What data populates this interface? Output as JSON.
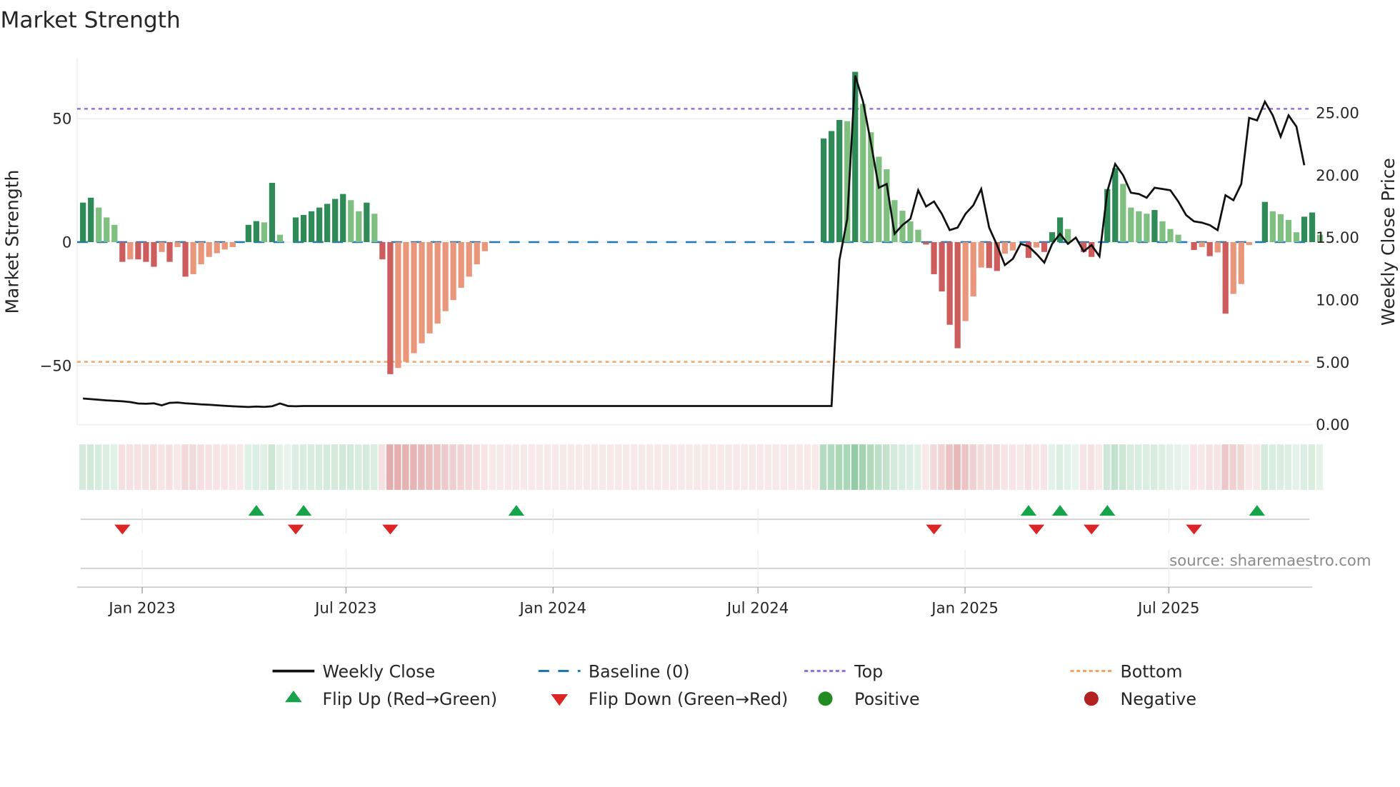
{
  "chart_data": {
    "type": "bar",
    "title": "Market Strength",
    "ylabel": "Market Strength",
    "y2label": "Weekly Close Price",
    "ylim": [
      -74,
      74.6
    ],
    "y2lim": [
      0,
      29.4
    ],
    "yticks": [
      {
        "v": 50,
        "label": "50"
      },
      {
        "v": 0,
        "label": "0"
      },
      {
        "v": -50,
        "label": "−50"
      }
    ],
    "y2ticks": [
      {
        "v": 0,
        "label": "0.00"
      },
      {
        "v": 5,
        "label": "5.00"
      },
      {
        "v": 10,
        "label": "10.00"
      },
      {
        "v": 15,
        "label": "15.00"
      },
      {
        "v": 20,
        "label": "20.00"
      },
      {
        "v": 25,
        "label": "25.00"
      }
    ],
    "xticks": [
      {
        "date": "2023-01-01",
        "label": "Jan 2023"
      },
      {
        "date": "2023-07-01",
        "label": "Jul 2023"
      },
      {
        "date": "2024-01-01",
        "label": "Jan 2024"
      },
      {
        "date": "2024-07-01",
        "label": "Jul 2024"
      },
      {
        "date": "2025-01-01",
        "label": "Jan 2025"
      },
      {
        "date": "2025-07-01",
        "label": "Jul 2025"
      }
    ],
    "start_date": "2022-11-07",
    "interval_days": 7,
    "top_level": 54,
    "bottom_level": -48.5,
    "baseline": 0,
    "strength": [
      16,
      18,
      14,
      10,
      7,
      -8,
      -7,
      -7,
      -8,
      -10,
      -4,
      -8,
      -2,
      -14,
      -13,
      -9,
      -6,
      -4.5,
      -3,
      -2,
      0,
      7,
      8.5,
      8,
      24,
      3,
      0,
      10,
      11,
      12.5,
      14,
      15.5,
      17.5,
      19.5,
      17,
      12.5,
      16,
      11.5,
      -7,
      -53.5,
      -51,
      -48.5,
      -45,
      -41,
      -37,
      -33,
      -28,
      -23.5,
      -18.5,
      -14,
      -9,
      -3.7,
      0,
      0,
      0,
      0,
      0,
      0,
      0,
      0,
      0,
      0,
      0,
      0,
      0,
      0,
      0,
      0,
      0,
      0,
      0,
      0,
      0,
      0,
      0,
      0,
      0,
      0,
      0,
      0,
      0,
      0,
      0,
      0,
      0,
      0,
      0,
      0,
      0,
      0,
      0,
      0,
      0,
      0,
      42,
      45,
      49.5,
      49,
      69,
      56,
      44.5,
      34.6,
      29.5,
      17,
      12.7,
      8.4,
      5,
      -1,
      -13,
      -20,
      -33.5,
      -43,
      -32,
      -22,
      -10.3,
      -10.5,
      -11.7,
      -4.7,
      -3.4,
      0,
      -6.4,
      -2.2,
      -4,
      4,
      10,
      5.3,
      0,
      -4,
      -6,
      0,
      21.5,
      30,
      23.6,
      14,
      12.5,
      11.5,
      13,
      8.4,
      5.3,
      3,
      0,
      -3.2,
      -2,
      -5.7,
      -4.2,
      -29,
      -21,
      -17,
      -1.2,
      0,
      16.3,
      12.5,
      11.3,
      9,
      4,
      10.3,
      12,
      3
    ],
    "weekly_close": [
      2.1,
      2.05,
      2.0,
      1.95,
      1.92,
      1.88,
      1.82,
      1.7,
      1.68,
      1.72,
      1.55,
      1.75,
      1.78,
      1.72,
      1.68,
      1.63,
      1.6,
      1.56,
      1.52,
      1.48,
      1.45,
      1.42,
      1.46,
      1.43,
      1.48,
      1.7,
      1.5,
      1.48,
      1.5,
      1.5,
      1.5,
      1.5,
      1.5,
      1.5,
      1.5,
      1.5,
      1.5,
      1.5,
      1.5,
      1.5,
      1.5,
      1.5,
      1.5,
      1.5,
      1.5,
      1.5,
      1.5,
      1.5,
      1.5,
      1.5,
      1.5,
      1.5,
      1.5,
      1.5,
      1.5,
      1.5,
      1.5,
      1.5,
      1.5,
      1.5,
      1.5,
      1.5,
      1.5,
      1.5,
      1.5,
      1.5,
      1.5,
      1.5,
      1.5,
      1.5,
      1.5,
      1.5,
      1.5,
      1.5,
      1.5,
      1.5,
      1.5,
      1.5,
      1.5,
      1.5,
      1.5,
      1.5,
      1.5,
      1.5,
      1.5,
      1.5,
      1.5,
      1.5,
      1.5,
      1.5,
      1.5,
      1.5,
      1.5,
      1.5,
      1.5,
      1.5,
      13.2,
      16.5,
      28,
      25.9,
      22.6,
      19,
      19.3,
      15.3,
      16,
      16.5,
      18.8,
      17.5,
      17.9,
      16.9,
      15.6,
      15.8,
      16.9,
      17.6,
      18.9,
      15.8,
      14.4,
      12.8,
      13.3,
      14.5,
      14.3,
      13.7,
      13,
      14.5,
      15.3,
      14.5,
      15,
      13.9,
      14.4,
      13.5,
      18.7,
      20.9,
      20,
      18.6,
      18.5,
      18.2,
      19,
      18.9,
      18.8,
      17.9,
      16.8,
      16.3,
      16.2,
      16,
      15.6,
      18.4,
      18,
      19.3,
      24.6,
      24.4,
      25.9,
      24.8,
      23.1,
      24.8,
      23.9,
      20.8
    ],
    "flip_up_weeks": [
      22,
      28,
      55,
      120,
      124,
      130,
      149
    ],
    "flip_down_weeks": [
      5,
      27,
      39,
      108,
      121,
      128,
      141
    ],
    "legend": [
      {
        "key": "weekly_close",
        "label": "Weekly Close"
      },
      {
        "key": "baseline",
        "label": "Baseline (0)"
      },
      {
        "key": "top",
        "label": "Top"
      },
      {
        "key": "bottom",
        "label": "Bottom"
      },
      {
        "key": "flip_up",
        "label": "Flip Up (Red→Green)"
      },
      {
        "key": "flip_down",
        "label": "Flip Down (Green→Red)"
      },
      {
        "key": "positive",
        "label": "Positive"
      },
      {
        "key": "negative",
        "label": "Negative"
      }
    ],
    "legend_position": "bottom",
    "source": "source: sharemaestro.com",
    "colors": {
      "pos_strong": "#2e8b57",
      "pos_weak": "#7fbf7f",
      "neg_strong": "#cd5c5c",
      "neg_weak": "#e9967a",
      "baseline": "#1f77b4",
      "top": "#9370db",
      "bottom": "#f4a460",
      "flip_up": "#16a34a",
      "flip_down": "#dc2626",
      "positive": "#228b22",
      "negative": "#b22222",
      "close": "#111111"
    }
  }
}
